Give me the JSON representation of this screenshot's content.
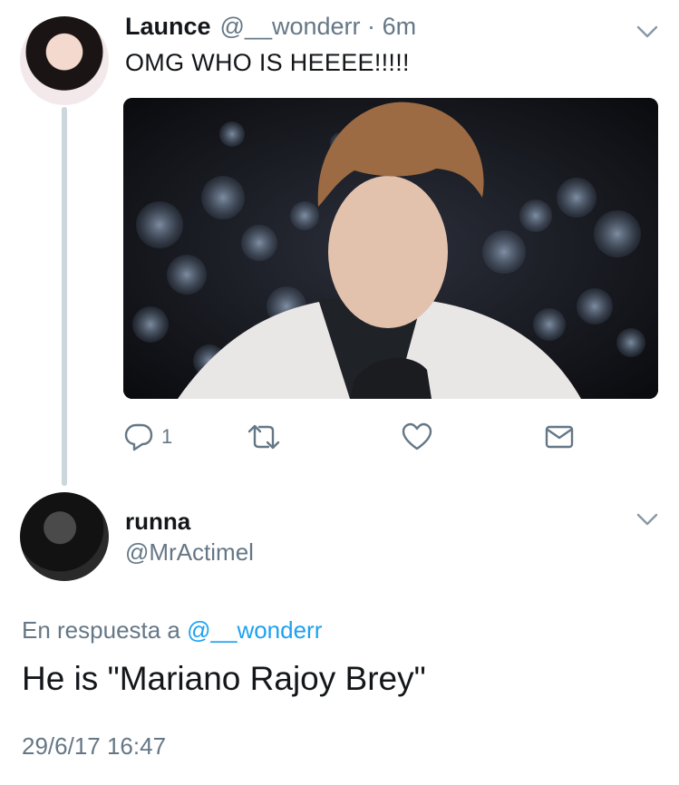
{
  "tweet": {
    "author_name": "Launce",
    "author_handle": "@__wonderr",
    "separator": "·",
    "age": "6m",
    "text": "OMG WHO IS HEEEE!!!!!",
    "reply_count": "1"
  },
  "reply": {
    "author_name": "runna",
    "author_handle": "@MrActimel",
    "in_reply_to_prefix": "En respuesta a",
    "in_reply_to_mention": "@__wonderr",
    "text": "He is \"Mariano Rajoy Brey\"",
    "timestamp": "29/6/17 16:47"
  },
  "icons": {
    "reply": "reply-bubble-icon",
    "retweet": "retweet-icon",
    "like": "heart-icon",
    "dm": "envelope-icon",
    "menu": "chevron-down-icon"
  },
  "colors": {
    "text": "#14171a",
    "secondary": "#657786",
    "link": "#1da1f2",
    "thread_line": "#ccd6dd",
    "icon_gray": "#657786"
  }
}
